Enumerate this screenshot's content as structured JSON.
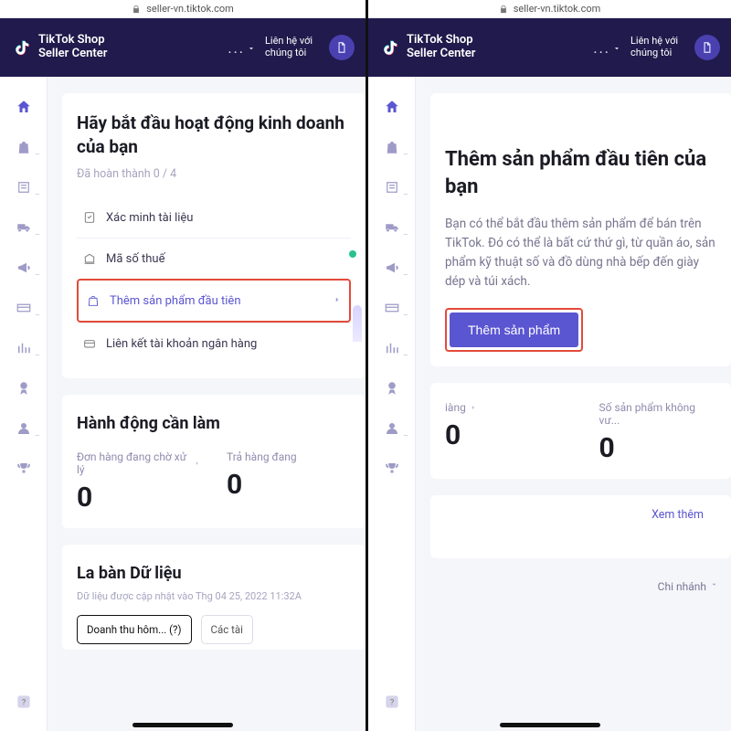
{
  "url": "seller-vn.tiktok.com",
  "brand": {
    "line1": "TikTok Shop",
    "line2": "Seller Center"
  },
  "header": {
    "dots": "...",
    "contact": "Liên hệ với chúng tôi"
  },
  "left": {
    "start": {
      "title": "Hãy bắt đầu hoạt động kinh doanh của bạn",
      "progress": "Đã hoàn thành 0 / 4",
      "tasks": {
        "verify": "Xác minh tài liệu",
        "tax": "Mã số thuế",
        "first_product": "Thêm sản phẩm đầu tiên",
        "bank": "Liên kết tài khoản ngân hàng"
      }
    },
    "todo": {
      "title": "Hành động cần làm",
      "m1_label": "Đơn hàng đang chờ xử lý",
      "m1_value": "0",
      "m2_label": "Trả hàng đang",
      "m2_value": "0"
    },
    "compass": {
      "title": "La bàn Dữ liệu",
      "updated": "Dữ liệu được cập nhật vào Thg 04 25, 2022 11:32A",
      "chip1": "Doanh thu hôm... (?)",
      "chip2": "Các tài"
    }
  },
  "right": {
    "detail": {
      "title": "Thêm sản phẩm đầu tiên của bạn",
      "desc": "Bạn có thể bắt đầu thêm sản phẩm để bán trên TikTok. Đó có thể là bất cứ thứ gì, từ quần áo, sản phẩm kỹ thuật số và đồ dùng nhà bếp đến giày dép và túi xách.",
      "cta": "Thêm sản phẩm"
    },
    "metrics": {
      "m1_label": "iàng",
      "m1_value": "0",
      "m2_label": "Số sản phẩm không vư...",
      "m2_value": "0"
    },
    "see_more": "Xem thêm",
    "footer": "Chi nhánh"
  }
}
